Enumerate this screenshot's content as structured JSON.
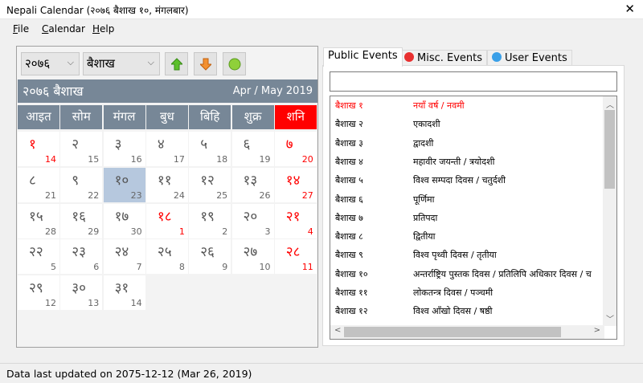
{
  "window": {
    "title": "Nepali Calendar (२०७६ बैशाख १०, मंगलबार)",
    "close": "✕"
  },
  "menu": [
    "File",
    "Calendar",
    "Help"
  ],
  "toolbar": {
    "year": "२०७६",
    "month": "बैशाख",
    "buttons": [
      "arrow-up-icon",
      "arrow-down-icon",
      "today-icon"
    ]
  },
  "calendar": {
    "header_left": "२०७६ बैशाख",
    "header_right": "Apr / May 2019",
    "weekdays": [
      "आइत",
      "सोम",
      "मंगल",
      "बुध",
      "बिहि",
      "शुक्र",
      "शनि"
    ],
    "weekend_color": "#ff0000",
    "first_weekday_index": 0,
    "selected_day": "१०",
    "days": [
      [
        "१",
        "14",
        true
      ],
      [
        "२",
        "15",
        false
      ],
      [
        "३",
        "16",
        false
      ],
      [
        "४",
        "17",
        false
      ],
      [
        "५",
        "18",
        false
      ],
      [
        "६",
        "19",
        false
      ],
      [
        "७",
        "20",
        true
      ],
      [
        "८",
        "21",
        false
      ],
      [
        "९",
        "22",
        false
      ],
      [
        "१०",
        "23",
        false
      ],
      [
        "११",
        "24",
        false
      ],
      [
        "१२",
        "25",
        false
      ],
      [
        "१३",
        "26",
        false
      ],
      [
        "१४",
        "27",
        true
      ],
      [
        "१५",
        "28",
        false
      ],
      [
        "१६",
        "29",
        false
      ],
      [
        "१७",
        "30",
        false
      ],
      [
        "१८",
        "1",
        true
      ],
      [
        "१९",
        "2",
        false
      ],
      [
        "२०",
        "3",
        false
      ],
      [
        "२१",
        "4",
        true
      ],
      [
        "२२",
        "5",
        false
      ],
      [
        "२३",
        "6",
        false
      ],
      [
        "२४",
        "7",
        false
      ],
      [
        "२५",
        "8",
        false
      ],
      [
        "२६",
        "9",
        false
      ],
      [
        "२७",
        "10",
        false
      ],
      [
        "२८",
        "11",
        true
      ],
      [
        "२९",
        "12",
        false
      ],
      [
        "३०",
        "13",
        false
      ],
      [
        "३१",
        "14",
        false
      ]
    ]
  },
  "tabs": [
    {
      "label": "Public Events",
      "active": true
    },
    {
      "label": "Misc. Events",
      "dot": "#e83030"
    },
    {
      "label": "User Events",
      "dot": "#3aa0e8"
    }
  ],
  "search": {
    "value": ""
  },
  "events": [
    {
      "date": "बैशाख १",
      "event": "नयाँ वर्ष / नवमी",
      "holiday": true
    },
    {
      "date": "बैशाख २",
      "event": "एकादशी"
    },
    {
      "date": "बैशाख ३",
      "event": "द्वादशी"
    },
    {
      "date": "बैशाख ४",
      "event": "महावीर जयन्ती / त्रयोदशी"
    },
    {
      "date": "बैशाख ५",
      "event": "विश्व सम्पदा दिवस / चतुर्दशी"
    },
    {
      "date": "बैशाख ६",
      "event": "पूर्णिमा"
    },
    {
      "date": "बैशाख ७",
      "event": "प्रतिपदा"
    },
    {
      "date": "बैशाख ८",
      "event": "द्वितीया"
    },
    {
      "date": "बैशाख ९",
      "event": "विश्व पृथ्वी दिवस / तृतीया"
    },
    {
      "date": "बैशाख १०",
      "event": "अन्तर्राष्ट्रिय पुस्तक दिवस / प्रतिलिपि अधिकार दिवस / च"
    },
    {
      "date": "बैशाख ११",
      "event": "लोकतन्त्र दिवस / पञ्चमी"
    },
    {
      "date": "बैशाख १२",
      "event": "विश्व आँखो दिवस / षष्ठी"
    }
  ],
  "status": "Data last updated on 2075-12-12 (Mar 26, 2019)"
}
